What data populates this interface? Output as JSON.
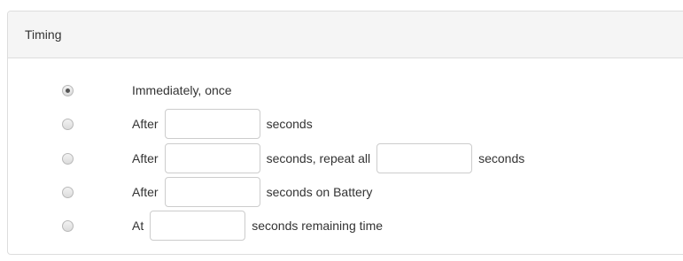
{
  "panel": {
    "title": "Timing"
  },
  "options": [
    {
      "checked": true,
      "parts": [
        "Immediately, once"
      ]
    },
    {
      "checked": false,
      "parts": [
        "After",
        "seconds"
      ]
    },
    {
      "checked": false,
      "parts": [
        "After",
        "seconds, repeat all",
        "seconds"
      ]
    },
    {
      "checked": false,
      "parts": [
        "After",
        "seconds on Battery"
      ]
    },
    {
      "checked": false,
      "parts": [
        "At",
        "seconds remaining time"
      ]
    }
  ],
  "fields": {
    "after_seconds": "",
    "repeat_after_seconds": "",
    "repeat_all_seconds": "",
    "battery_after_seconds": "",
    "remaining_time_seconds": ""
  }
}
